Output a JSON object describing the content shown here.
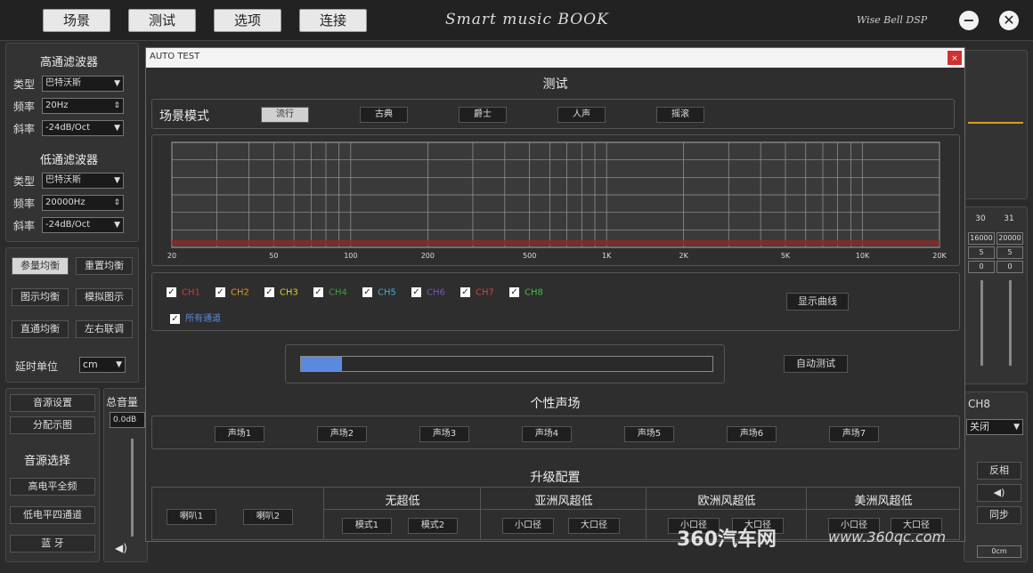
{
  "topbar": {
    "tabs": [
      "场景",
      "测试",
      "选项",
      "连接"
    ],
    "brand": "Smart music BOOK",
    "brand2": "Wise Bell DSP",
    "minimize": "−",
    "close": "✕"
  },
  "left": {
    "hp_title": "高通滤波器",
    "lp_title": "低通滤波器",
    "type_label": "类型",
    "freq_label": "频率",
    "slope_label": "斜率",
    "hp_type": "巴特沃斯",
    "hp_freq": "20Hz",
    "hp_slope": "-24dB/Oct",
    "lp_type": "巴特沃斯",
    "lp_freq": "20000Hz",
    "lp_slope": "-24dB/Oct",
    "eq_buttons": [
      "参量均衡",
      "重置均衡",
      "图示均衡",
      "模拟图示",
      "直通均衡",
      "左右联调"
    ],
    "delay_label": "延时单位",
    "delay_unit": "cm",
    "bottom_buttons": [
      "音源设置",
      "分配示图"
    ],
    "source_title": "音源选择",
    "source_buttons": [
      "高电平全频",
      "低电平四通道",
      "蓝 牙"
    ],
    "master_label": "总音量",
    "master_value": "0.0dB"
  },
  "dialog": {
    "title": "AUTO TEST",
    "close": "×",
    "test_heading": "测试",
    "scene_label": "场景模式",
    "scene_buttons": [
      "流行",
      "古典",
      "爵士",
      "人声",
      "摇滚"
    ],
    "x_ticks": [
      "20",
      "50",
      "100",
      "200",
      "500",
      "1K",
      "2K",
      "5K",
      "10K",
      "20K"
    ],
    "channels": [
      {
        "label": "CH1",
        "color": "#d83a3a"
      },
      {
        "label": "CH2",
        "color": "#e09a2a"
      },
      {
        "label": "CH3",
        "color": "#e0d020"
      },
      {
        "label": "CH4",
        "color": "#3aa03a"
      },
      {
        "label": "CH5",
        "color": "#3ab0e0"
      },
      {
        "label": "CH6",
        "color": "#8050c0"
      },
      {
        "label": "CH7",
        "color": "#d84040"
      },
      {
        "label": "CH8",
        "color": "#40c040"
      }
    ],
    "all_channels_label": "所有通道",
    "all_channels_color": "#5a8ad8",
    "show_curve": "显示曲线",
    "progress": 0.1,
    "auto_test": "自动测试",
    "personal_heading": "个性声场",
    "sound_fields": [
      "声场1",
      "声场2",
      "声场3",
      "声场4",
      "声场5",
      "声场6",
      "声场7"
    ],
    "upgrade_heading": "升级配置",
    "speaker_buttons": [
      "喇叭1",
      "喇叭2"
    ],
    "groups": [
      {
        "title": "无超低",
        "buttons": [
          "模式1",
          "模式2"
        ]
      },
      {
        "title": "亚洲风超低",
        "buttons": [
          "小口径",
          "大口径"
        ]
      },
      {
        "title": "欧洲风超低",
        "buttons": [
          "小口径",
          "大口径"
        ]
      },
      {
        "title": "美洲风超低",
        "buttons": [
          "小口径",
          "大口径"
        ]
      }
    ]
  },
  "right": {
    "col_labels": [
      "30",
      "31"
    ],
    "freq_vals": [
      "16000",
      "20000"
    ],
    "q_vals": [
      "5",
      "5"
    ],
    "gain_vals": [
      "0",
      "0"
    ],
    "channel": "CH8",
    "channel_state": "关闭",
    "side_buttons": [
      "反相",
      "同步"
    ],
    "delay_value": "0cm"
  },
  "watermark": {
    "brand": "360汽车网",
    "url": "www.360qc.com"
  }
}
